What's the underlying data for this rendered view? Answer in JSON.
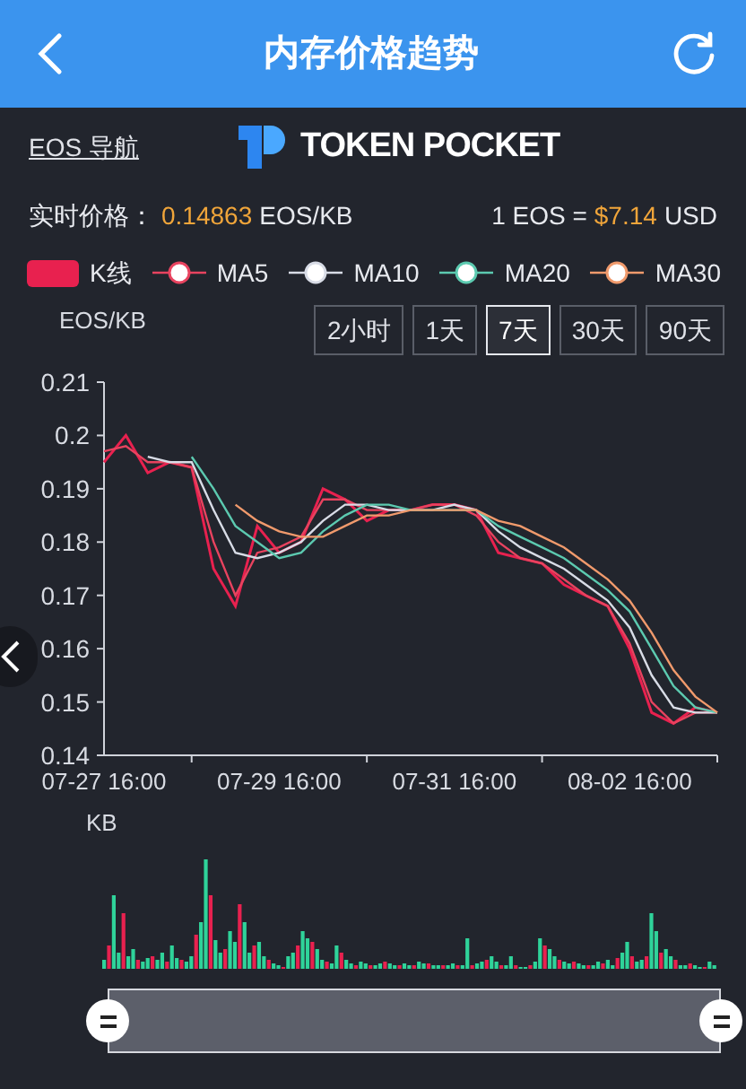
{
  "header": {
    "title": "内存价格趋势"
  },
  "nav_link": "EOS 导航",
  "logo": {
    "text": "TOKEN POCKET"
  },
  "price": {
    "label": "实时价格：",
    "value": "0.14863",
    "unit": "EOS/KB"
  },
  "rate": {
    "prefix": "1 EOS =",
    "value": "$7.14",
    "suffix": "USD"
  },
  "ranges": [
    {
      "label": "2小时",
      "selected": false
    },
    {
      "label": "1天",
      "selected": false
    },
    {
      "label": "7天",
      "selected": true
    },
    {
      "label": "30天",
      "selected": false
    },
    {
      "label": "90天",
      "selected": false
    }
  ],
  "chart_data": {
    "type": "line",
    "ylabel": "EOS/KB",
    "ylim": [
      0.14,
      0.21
    ],
    "categories": [
      "07-27 16:00",
      null,
      null,
      null,
      null,
      null,
      null,
      null,
      "07-29 16:00",
      null,
      null,
      null,
      null,
      null,
      null,
      null,
      "07-31 16:00",
      null,
      null,
      null,
      null,
      null,
      null,
      null,
      "08-02 16:00",
      null,
      null,
      null,
      null
    ],
    "series": [
      {
        "name": "K线",
        "color": "#e8214f",
        "values": [
          0.195,
          0.2,
          0.193,
          0.195,
          0.194,
          0.175,
          0.168,
          0.183,
          0.178,
          0.18,
          0.19,
          0.188,
          0.184,
          0.186,
          0.186,
          0.187,
          0.187,
          0.186,
          0.178,
          0.177,
          0.176,
          0.172,
          0.17,
          0.168,
          0.16,
          0.148,
          0.146,
          0.149,
          0.148
        ]
      },
      {
        "name": "MA5",
        "color": "#e8435f",
        "values": [
          0.197,
          0.198,
          0.195,
          0.195,
          0.194,
          0.18,
          0.17,
          0.178,
          0.179,
          0.181,
          0.188,
          0.188,
          0.186,
          0.186,
          0.186,
          0.187,
          0.187,
          0.185,
          0.18,
          0.177,
          0.176,
          0.173,
          0.17,
          0.168,
          0.161,
          0.15,
          0.146,
          0.148,
          0.148
        ]
      },
      {
        "name": "MA10",
        "color": "#d8dce6",
        "values": [
          null,
          null,
          0.196,
          0.195,
          0.195,
          0.186,
          0.178,
          0.177,
          0.178,
          0.18,
          0.184,
          0.187,
          0.187,
          0.186,
          0.186,
          0.186,
          0.187,
          0.186,
          0.182,
          0.179,
          0.177,
          0.175,
          0.172,
          0.169,
          0.164,
          0.155,
          0.149,
          0.148,
          0.148
        ]
      },
      {
        "name": "MA20",
        "color": "#5ccab0",
        "values": [
          null,
          null,
          null,
          null,
          0.196,
          0.19,
          0.183,
          0.18,
          0.177,
          0.178,
          0.182,
          0.185,
          0.187,
          0.187,
          0.186,
          0.186,
          0.186,
          0.186,
          0.183,
          0.181,
          0.179,
          0.177,
          0.174,
          0.171,
          0.167,
          0.16,
          0.153,
          0.149,
          0.148
        ]
      },
      {
        "name": "MA30",
        "color": "#f09a6c",
        "values": [
          null,
          null,
          null,
          null,
          null,
          null,
          0.187,
          0.184,
          0.182,
          0.181,
          0.181,
          0.183,
          0.185,
          0.185,
          0.186,
          0.186,
          0.186,
          0.186,
          0.184,
          0.183,
          0.181,
          0.179,
          0.176,
          0.173,
          0.169,
          0.163,
          0.156,
          0.151,
          0.148
        ]
      }
    ],
    "yticks": [
      0.14,
      0.15,
      0.16,
      0.17,
      0.18,
      0.19,
      0.2,
      0.21
    ]
  },
  "volume": {
    "label": "KB"
  }
}
